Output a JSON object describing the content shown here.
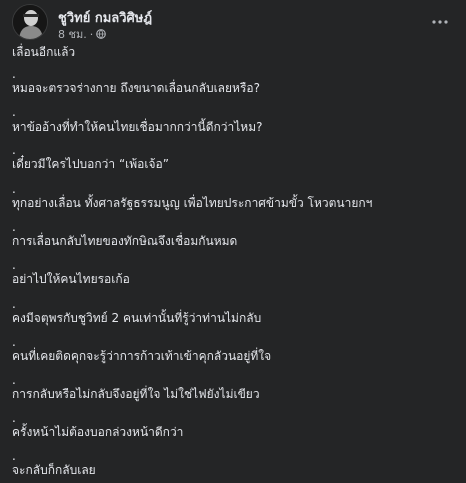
{
  "post": {
    "author": "ชูวิทย์ กมลวิศิษฎ์",
    "time": "8 ชม.",
    "separator": "·",
    "more_icon": "more-horizontal-icon",
    "lines": [
      "เลื่อนอีกแล้ว",
      ".",
      "หมอจะตรวจร่างกาย ถึงขนาดเลื่อนกลับเลยหรือ?",
      ".",
      "หาข้ออ้างที่ทำให้คนไทยเชื่อมากกว่านี้ดีกว่าไหม?",
      ".",
      "เดี๋ยวมีใครไปบอกว่า “เพ้อเจ้อ”",
      ".",
      "ทุกอย่างเลื่อน ทั้งศาลรัฐธรรมนูญ เพื่อไทยประกาศข้ามขั้ว โหวตนายกฯ",
      ".",
      "การเลื่อนกลับไทยของทักษิณจึงเชื่อมกันหมด",
      ".",
      "อย่าไปให้คนไทยรอเก้อ",
      ".",
      "คงมีจตุพรกับชูวิทย์ 2 คนเท่านั้นที่รู้ว่าท่านไม่กลับ",
      ".",
      "คนที่เคยติดคุกจะรู้ว่าการก้าวเท้าเข้าคุกลัวนอยู่ที่ใจ",
      ".",
      "การกลับหรือไม่กลับจึงอยู่ที่ใจ ไม่ใช่ไฟยังไม่เขียว",
      ".",
      "ครั้งหน้าไม่ต้องบอกล่วงหน้าดีกว่า",
      ".",
      "จะกลับก็กลับเลย"
    ]
  }
}
